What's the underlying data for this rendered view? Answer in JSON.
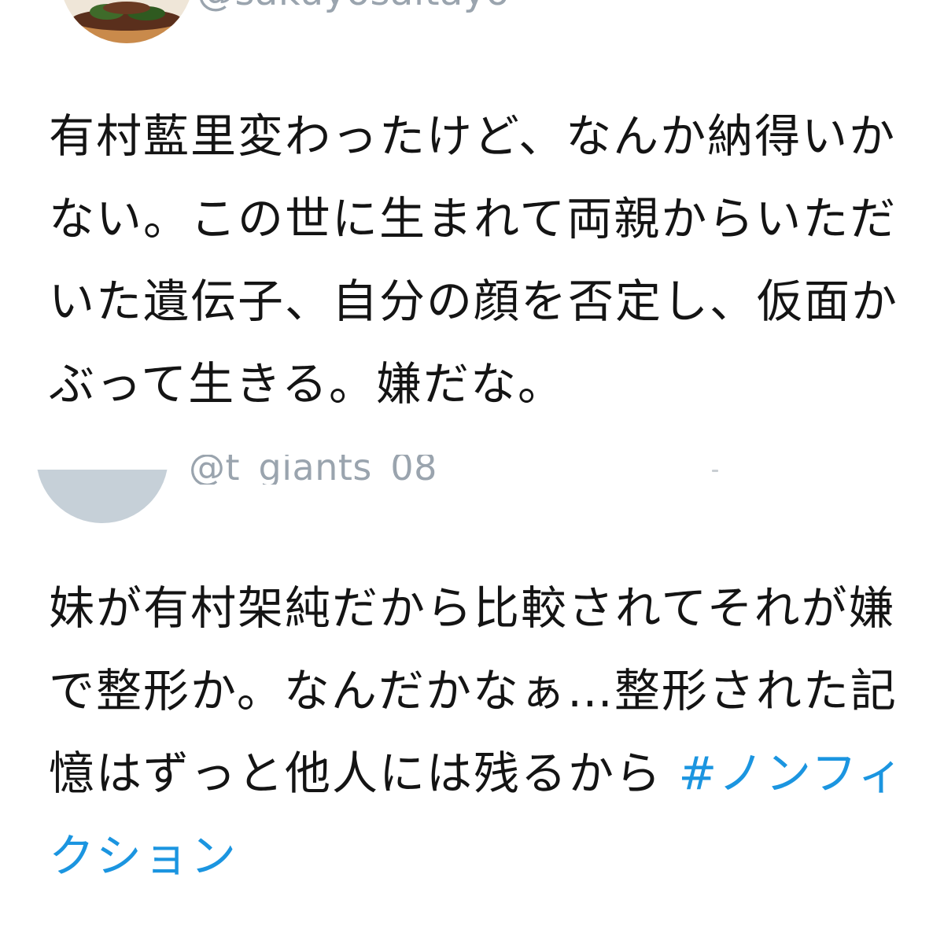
{
  "tweets": [
    {
      "handle": "@sakuyosaitayo",
      "text": "有村藍里変わったけど、なんか納得いかない。この世に生まれて両親からいただいた遺伝子、自分の顔を否定し、仮面かぶって生きる。嫌だな。"
    },
    {
      "handle": "@t_giants_08",
      "text": "妹が有村架純だから比較されてそれが嫌で整形か。なんだかなぁ…整形された記憶はずっと他人には残るから ",
      "hashtag": "#ノンフィクション"
    }
  ],
  "colors": {
    "text": "#141414",
    "handle": "#9aa4ae",
    "hashtag": "#1b95e0",
    "avatar_placeholder": "#c6d0d8"
  }
}
